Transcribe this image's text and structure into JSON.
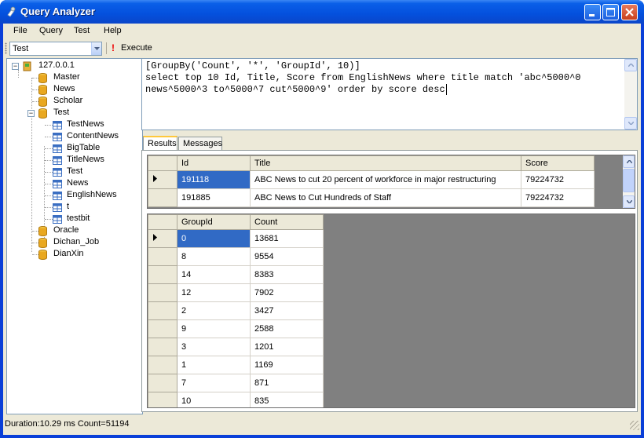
{
  "window": {
    "title": "Query Analyzer"
  },
  "menu": [
    "File",
    "Query",
    "Test",
    "Help"
  ],
  "toolbar": {
    "database": "Test",
    "execute_label": "Execute"
  },
  "tree": {
    "server": "127.0.0.1",
    "databases": [
      "Master",
      "News",
      "Scholar",
      "Test"
    ],
    "tables": [
      "TestNews",
      "ContentNews",
      "BigTable",
      "TitleNews",
      "Test",
      "News",
      "EnglishNews",
      "t",
      "testbit"
    ],
    "more_databases": [
      "Oracle",
      "Dichan_Job",
      "DianXin"
    ]
  },
  "editor": {
    "line1": "[GroupBy('Count', '*', 'GroupId', 10)]",
    "line2": "select top 10 Id, Title, Score from EnglishNews where title match 'abc^5000^0",
    "line3": "news^5000^3 to^5000^7 cut^5000^9' order by score desc"
  },
  "tabs": [
    "Results",
    "Messages"
  ],
  "grid1": {
    "columns": [
      "Id",
      "Title",
      "Score"
    ],
    "rows": [
      [
        "191118",
        "ABC News to cut 20 percent of workforce in major restructuring",
        "79224732"
      ],
      [
        "191885",
        "ABC News to Cut Hundreds of Staff",
        "79224732"
      ]
    ]
  },
  "grid2": {
    "columns": [
      "GroupId",
      "Count"
    ],
    "rows": [
      [
        "0",
        "13681"
      ],
      [
        "8",
        "9554"
      ],
      [
        "14",
        "8383"
      ],
      [
        "12",
        "7902"
      ],
      [
        "2",
        "3427"
      ],
      [
        "9",
        "2588"
      ],
      [
        "3",
        "1201"
      ],
      [
        "1",
        "1169"
      ],
      [
        "7",
        "871"
      ],
      [
        "10",
        "835"
      ]
    ]
  },
  "status": "Duration:10.29 ms Count=51194",
  "colors": {
    "title_bar": "#0450dd",
    "selection": "#316ac5",
    "tab_highlight": "#ffc83c"
  }
}
